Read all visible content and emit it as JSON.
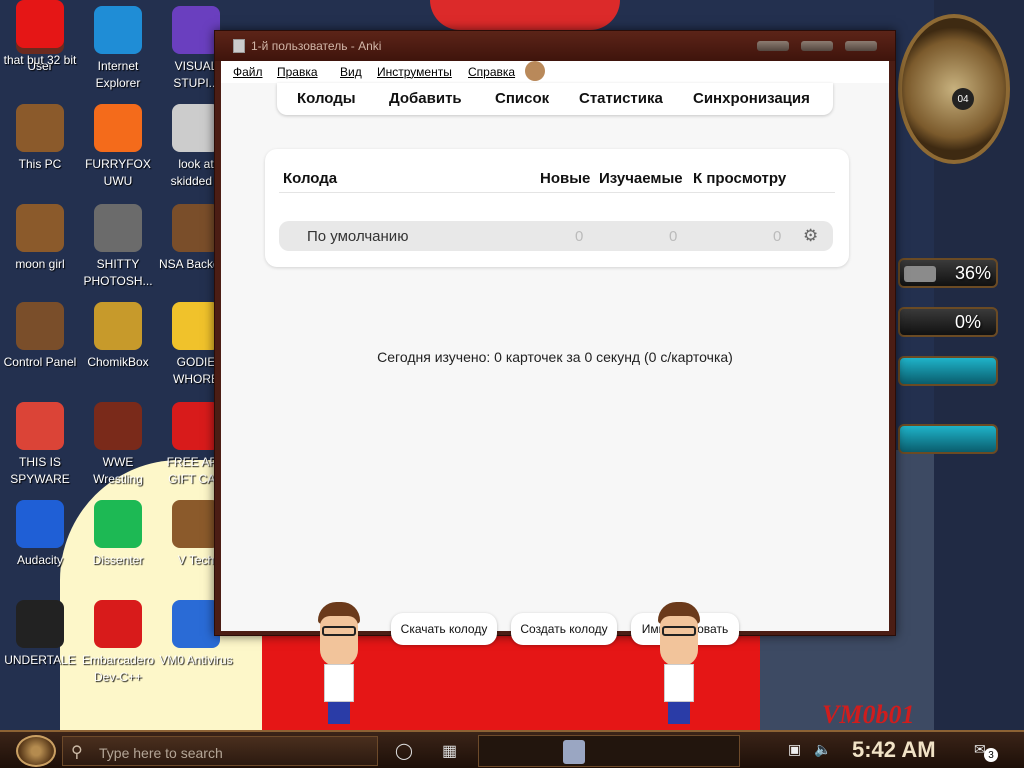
{
  "desktop": {
    "icons": [
      {
        "label": "User",
        "icon": "user-folder-icon",
        "color": "#6b2a1f"
      },
      {
        "label": "Internet Explorer",
        "icon": "edge-browser-icon",
        "color": "#1f8dd6"
      },
      {
        "label": "VISUAL STUPI...",
        "icon": "visual-studio-icon",
        "color": "#6a3fbf"
      },
      {
        "label": "This PC",
        "icon": "computer-icon",
        "color": "#8b5a2b"
      },
      {
        "label": "FURRYFOX UWU",
        "icon": "firefox-icon",
        "color": "#f46b1b"
      },
      {
        "label": "look at skidded c",
        "icon": "copy-icon",
        "color": "#cccccc"
      },
      {
        "label": "moon girl",
        "icon": "file-icon",
        "color": "#8b5a2b"
      },
      {
        "label": "SHITTY PHOTOSH...",
        "icon": "gimp-icon",
        "color": "#6b6b6b"
      },
      {
        "label": "NSA Backdoo",
        "icon": "folder-icon",
        "color": "#7a4e2a"
      },
      {
        "label": "Control Panel",
        "icon": "control-panel-icon",
        "color": "#7a4e2a"
      },
      {
        "label": "ChomikBox",
        "icon": "hamster-app-icon",
        "color": "#c79a2b"
      },
      {
        "label": "GODIE WHORE",
        "icon": "app-icon",
        "color": "#f0c22b"
      },
      {
        "label": "THIS IS SPYWARE",
        "icon": "chrome-icon",
        "color": "#db4437"
      },
      {
        "label": "WWE Wrestling",
        "icon": "oven-icon",
        "color": "#7a2a1a"
      },
      {
        "label": "FREE APP GIFT CAR",
        "icon": "apple-icon",
        "color": "#d81b1b"
      },
      {
        "label": "Audacity",
        "icon": "audacity-icon",
        "color": "#1f5fd6"
      },
      {
        "label": "Dissenter",
        "icon": "spotify-icon",
        "color": "#1db954"
      },
      {
        "label": "V Tech",
        "icon": "app-icon",
        "color": "#8b5a2b"
      },
      {
        "label": "UNDERTALE",
        "icon": "unity-icon",
        "color": "#222222"
      },
      {
        "label": "Embarcadero Dev-C++",
        "icon": "devcpp-icon",
        "color": "#d81b1b"
      },
      {
        "label": "VM0 Antivirus",
        "icon": "shield-icon",
        "color": "#2a6bd6"
      },
      {
        "label": "that but 32 bit",
        "icon": "app-icon",
        "color": "#e51616"
      }
    ],
    "gauges": [
      {
        "label": "36%",
        "value": 0.36,
        "color": "#8b8b8b"
      },
      {
        "label": "0%",
        "value": 0.0,
        "color": "#3aa64b"
      }
    ],
    "clock_day": "04",
    "watermark": "VM0b01"
  },
  "window": {
    "title": "1-й пользователь - Anki",
    "menu": [
      "Файл",
      "Правка",
      "Вид",
      "Инструменты",
      "Справка"
    ],
    "nav": [
      "Колоды",
      "Добавить",
      "Список",
      "Статистика",
      "Синхронизация"
    ],
    "deck_table": {
      "headers": {
        "deck": "Колода",
        "new": "Новые",
        "learn": "Изучаемые",
        "review": "К просмотру"
      },
      "rows": [
        {
          "name": "По умолчанию",
          "new": "0",
          "learn": "0",
          "review": "0"
        }
      ]
    },
    "studied_today": "Сегодня изучено: 0 карточек за 0 секунд (0 с/карточка)",
    "buttons": {
      "download": "Скачать колоду",
      "create": "Создать колоду",
      "import": "Импортировать"
    }
  },
  "taskbar": {
    "search_placeholder": "Type here to search",
    "time": "5:42 AM",
    "notifications": "3"
  }
}
